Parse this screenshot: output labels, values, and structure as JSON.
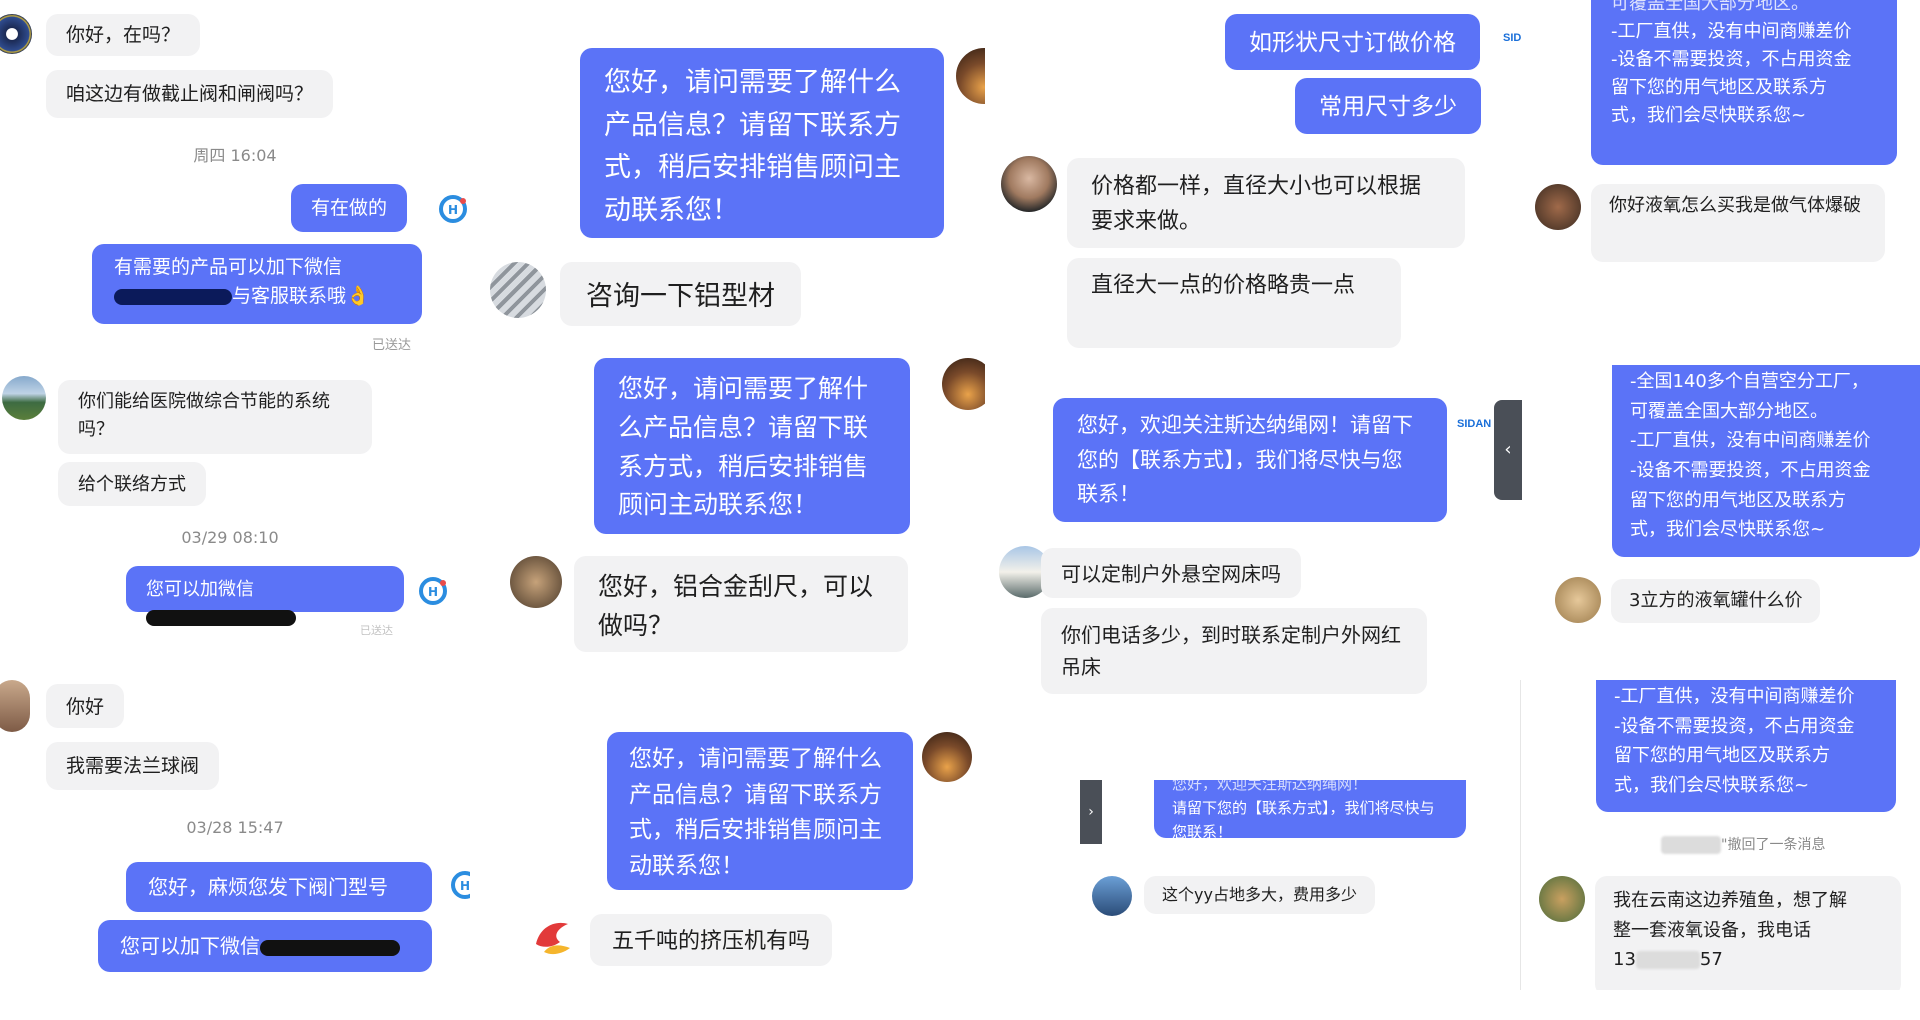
{
  "col1": {
    "a1": {
      "line1": "你好，在吗？",
      "line2": "咱这边有做截止阀和闸阀吗？",
      "time": "周四 16:04"
    },
    "r1": {
      "msg1": "有在做的",
      "msg2_line1": "有需要的产品可以加下微信",
      "msg2_line2": "与客服联系哦",
      "status": "已送达"
    },
    "a2": {
      "line1a": "你们能给医院做综合节能的系统",
      "line1b": "吗？",
      "line2": "给个联络方式",
      "time": "03/29 08:10"
    },
    "r2": {
      "msg": "您可以加微信",
      "status": "已送达"
    },
    "a3": {
      "line1": "你好",
      "line2": "我需要法兰球阀",
      "time": "03/28 15:47"
    },
    "r3": {
      "msg1": "您好，麻烦您发下阀门型号",
      "msg2": "您可以加下微信"
    }
  },
  "col2": {
    "auto": {
      "text": "您好，请问需要了解什么产品信息？请留下联系方式，稍后安排销售顾问主动联系您！"
    },
    "q1": "咨询一下铝型材",
    "q2": "您好，铝合金刮尺，可以做吗？",
    "q3": "五千吨的挤压机有吗"
  },
  "col3": {
    "r1": "如形状尺寸订做价格",
    "r2": "常用尺寸多少",
    "a1": "价格都一样，直径大小也可以根据要求来做。",
    "a2": "直径大一点的价格略贵一点",
    "brand1": "SID",
    "auto": "您好，欢迎关注斯达纳绳网！请留下您的【联系方式】，我们将尽快与您联系！",
    "brand2": "SIDAN",
    "q1": "可以定制户外悬空网床吗",
    "q2": "你们电话多少，到时联系定制户外网红吊床",
    "auto_small_top": "您好，欢迎关注斯达纳绳网！",
    "auto_small": "请留下您的【联系方式】，我们将尽快与您联系！",
    "q3": "这个yy占地多大，费用多少"
  },
  "col4": {
    "top_cut": "可覆盖全国大部分地区。",
    "top_lines": [
      "-工厂直供，没有中间商赚差价",
      "-设备不需要投资，不占用资金",
      "留下您的用气地区及联系方",
      "式，我们会尽快联系您~"
    ],
    "q1": "你好液氧怎么买我是做气体爆破",
    "mid_lines": [
      "-全国140多个自营空分工厂，",
      "可覆盖全国大部分地区。",
      "-工厂直供，没有中间商赚差价",
      "-设备不需要投资，不占用资金",
      "留下您的用气地区及联系方",
      "式，我们会尽快联系您~"
    ],
    "q2": "3立方的液氧罐什么价",
    "bot_lines": [
      "-工厂直供，没有中间商赚差价",
      "-设备不需要投资，不占用资金",
      "留下您的用气地区及联系方",
      "式，我们会尽快联系您~"
    ],
    "recall": "\"撤回了一条消息",
    "q3_line1": "我在云南这边养殖鱼，想了解",
    "q3_line2": "整一套液氧设备，我电话",
    "q3_phone_a": "13",
    "q3_phone_b": "57"
  },
  "colors": {
    "bubble_out": "#5b73f7",
    "bubble_in": "#f2f2f3",
    "time": "#8a8a8a"
  }
}
